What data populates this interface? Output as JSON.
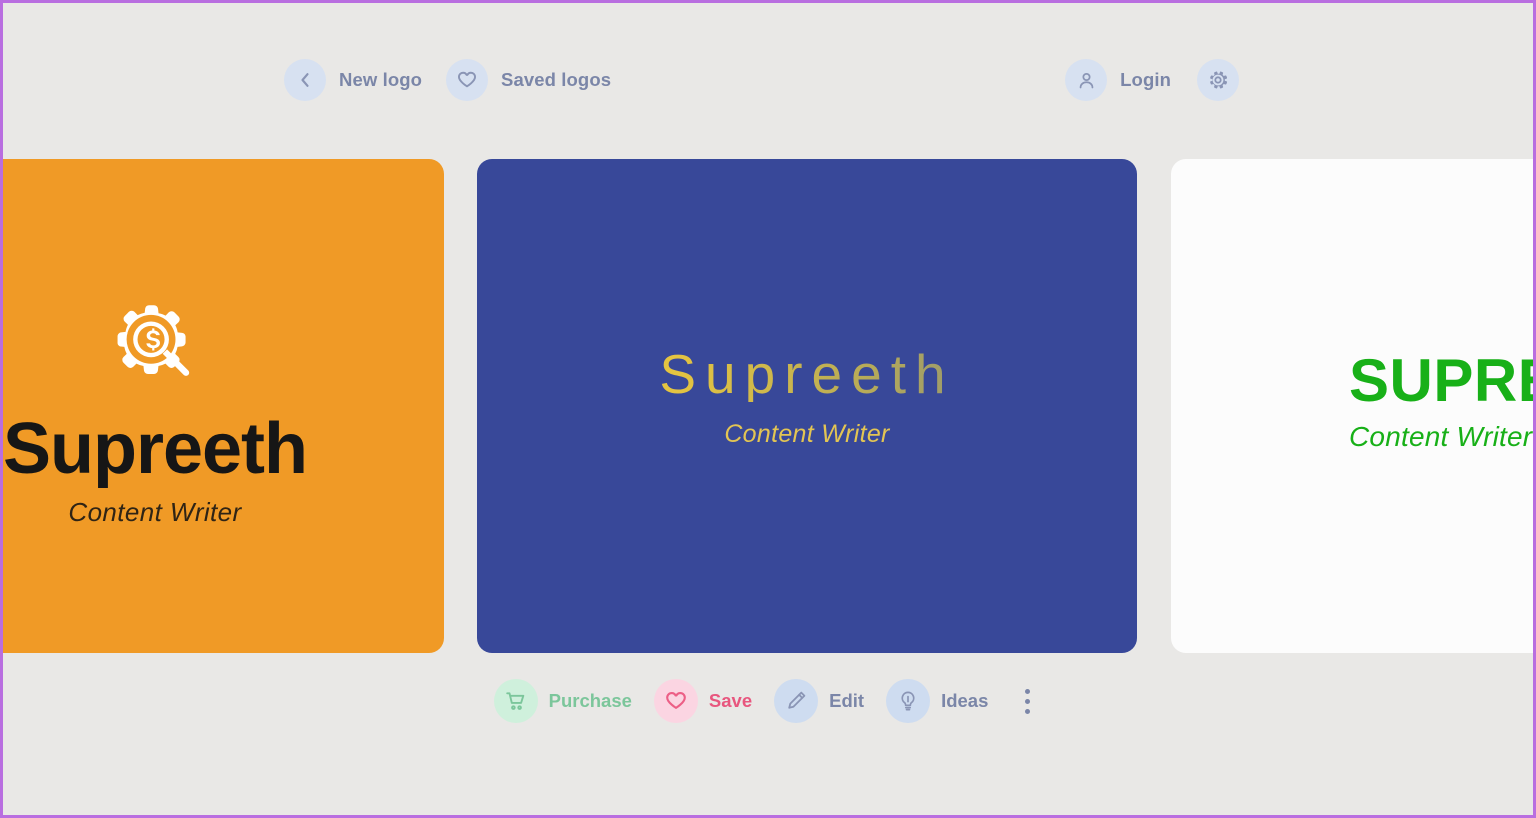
{
  "app": {
    "background_color": "#e9e8e6",
    "frame_border_color": "#b96ee0"
  },
  "header": {
    "left_nav": [
      {
        "id": "new-logo",
        "label": "New logo",
        "icon": "chevron-left-icon",
        "circle_color": "#d7e1f1",
        "text_color": "#7b86a8"
      },
      {
        "id": "saved-logos",
        "label": "Saved logos",
        "icon": "heart-icon",
        "circle_color": "#d7e1f1",
        "text_color": "#7b86a8"
      }
    ],
    "right_nav": [
      {
        "id": "login",
        "label": "Login",
        "icon": "user-icon",
        "circle_color": "#d7e1f1",
        "text_color": "#7b86a8"
      },
      {
        "id": "settings",
        "label": "",
        "icon": "gear-icon",
        "circle_color": "#d7e1f1",
        "text_color": "#7b86a8"
      }
    ]
  },
  "cards": [
    {
      "id": "logo-card-orange",
      "background_color": "#f09a26",
      "icon": "gear-magnifier-dollar-icon",
      "title": "Supreeth",
      "tagline": "Content Writer",
      "title_color": "#161616",
      "tagline_color": "#2f2415"
    },
    {
      "id": "logo-card-blue",
      "background_color": "#384899",
      "title": "Supreeth",
      "tagline": "Content Writer",
      "title_color": "#e8c83e",
      "title_gradient_end_color": "#7f8a80",
      "tagline_color": "#e3c553"
    },
    {
      "id": "logo-card-white",
      "background_color": "#fcfcfc",
      "title": "SUPREETH",
      "tagline": "Content Writer",
      "title_color": "#18b018",
      "tagline_color": "#18b018"
    }
  ],
  "toolbar": {
    "actions": [
      {
        "id": "purchase",
        "label": "Purchase",
        "icon": "shopping-cart-icon",
        "circle_color": "#cff0dc",
        "text_color": "#7cc69b"
      },
      {
        "id": "save",
        "label": "Save",
        "icon": "heart-icon",
        "circle_color": "#fbd5e2",
        "text_color": "#e8567e"
      },
      {
        "id": "edit",
        "label": "Edit",
        "icon": "pencil-icon",
        "circle_color": "#cedcf0",
        "text_color": "#7b86a8"
      },
      {
        "id": "ideas",
        "label": "Ideas",
        "icon": "lightbulb-icon",
        "circle_color": "#cedcf0",
        "text_color": "#7b86a8"
      }
    ],
    "more_menu": {
      "id": "more",
      "icon": "kebab-menu-icon",
      "dot_color": "#7b86a8"
    }
  }
}
